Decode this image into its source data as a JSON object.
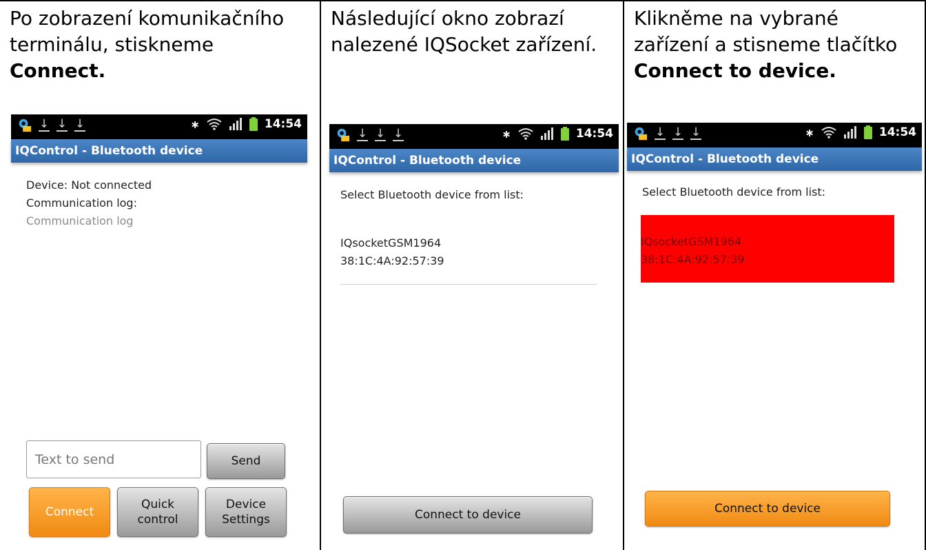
{
  "columns": [
    {
      "caption_line1": "Po zobrazení komunikačního",
      "caption_line2": "terminálu, stiskneme",
      "caption_bold": "Connect.",
      "status_time": "14:54",
      "app_title": "IQControl - Bluetooth device",
      "device_status": "Device: Not connected",
      "log_label": "Communication log:",
      "log_text": "Communication log",
      "input_placeholder": "Text to send",
      "send_label": "Send",
      "connect_label": "Connect",
      "quick_control_line1": "Quick",
      "quick_control_line2": "control",
      "device_settings_line1": "Device",
      "device_settings_line2": "Settings"
    },
    {
      "caption_line1": "Následující okno zobrazí",
      "caption_line2": "nalezené IQSocket zařízení.",
      "status_time": "14:54",
      "app_title": "IQControl - Bluetooth device",
      "select_label": "Select Bluetooth device from list:",
      "device_name": "IQsocketGSM1964",
      "device_mac": "38:1C:4A:92:57:39",
      "connect_device_label": "Connect to device"
    },
    {
      "caption_line1": "Klikněme na vybrané",
      "caption_line2": "zařízení a stisneme tlačítko",
      "caption_bold": "Connect to device.",
      "status_time": "14:54",
      "app_title": "IQControl - Bluetooth device",
      "select_label": "Select Bluetooth device from list:",
      "device_name": "IQsocketGSM1964",
      "device_mac": "38:1C:4A:92:57:39",
      "connect_device_label": "Connect to device"
    }
  ],
  "colors": {
    "selected_row": "#ff0000",
    "accent_orange": "#f08a12",
    "titlebar_blue": "#2e66a8"
  },
  "icons": [
    "gear-mail-icon",
    "download-icon",
    "bluetooth-icon",
    "wifi-icon",
    "signal-icon",
    "battery-icon"
  ]
}
